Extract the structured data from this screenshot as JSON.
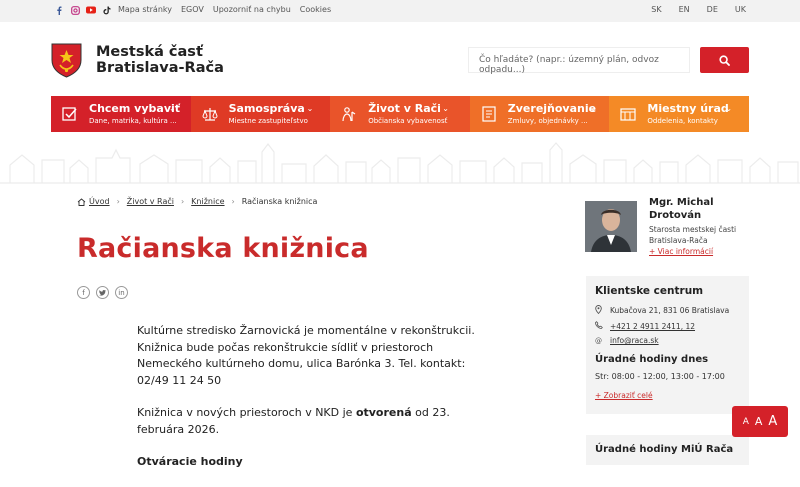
{
  "topbar": {
    "social": [
      "facebook-icon",
      "instagram-icon",
      "youtube-icon",
      "tiktok-icon"
    ],
    "links": [
      "Mapa stránky",
      "EGOV",
      "Upozorniť na chybu",
      "Cookies"
    ],
    "languages": [
      "SK",
      "EN",
      "DE",
      "UK"
    ]
  },
  "header": {
    "logo_line1": "Mestská časť",
    "logo_line2": "Bratislava-Rača",
    "search_placeholder": "Čo hľadáte? (napr.: územný plán, odvoz odpadu...)"
  },
  "nav": [
    {
      "title": "Chcem vybaviť",
      "subtitle": "Dane, matrika, kultúra ...",
      "color": "#d42129",
      "icon": "checkbox-icon"
    },
    {
      "title": "Samospráva",
      "subtitle": "Miestne zastupiteľstvo",
      "color": "#df3a25",
      "icon": "scales-icon"
    },
    {
      "title": "Život v Rači",
      "subtitle": "Občianska vybavenosť",
      "color": "#e9542a",
      "icon": "person-icon"
    },
    {
      "title": "Zverejňovanie",
      "subtitle": "Zmluvy, objednávky ...",
      "color": "#ef6f28",
      "icon": "document-icon"
    },
    {
      "title": "Miestny úrad",
      "subtitle": "Oddelenia, kontakty",
      "color": "#f48a26",
      "icon": "building-icon"
    }
  ],
  "breadcrumb": [
    "Úvod",
    "Život v Rači",
    "Knižnice",
    "Račianska knižnica"
  ],
  "page_title": "Račianska knižnica",
  "content": {
    "p1": "Kultúrne stredisko Žarnovická je momentálne v rekonštrukcii. Knižnica bude počas rekonštrukcie sídliť v priestoroch Nemeckého kultúrneho domu, ulica Barónka 3. Tel. kontakt:  02/49 11 24 50",
    "p2_a": "Knižnica v nových priestoroch v NKD je ",
    "p2_b": "otvorená",
    "p2_c": " od 23. februára 2026.",
    "p3": "Otváracie hodiny"
  },
  "mayor": {
    "name_line1": "Mgr. Michal",
    "name_line2": "Drotován",
    "role_line1": "Starosta mestskej časti",
    "role_line2": "Bratislava-Rača",
    "more": "+ Viac informácií"
  },
  "client_center": {
    "title": "Klientske centrum",
    "address": "Kubačova 21, 831 06 Bratislava",
    "phone": "+421 2 4911 2411, 12",
    "email": "info@raca.sk",
    "hours_title": "Úradné hodiny dnes",
    "hours": "Str: 08:00 - 12:00, 13:00 - 17:00",
    "show_all": "+ Zobraziť celé"
  },
  "next_box_title": "Úradné hodiny MiÚ Rača",
  "a11y": [
    "A",
    "A",
    "A"
  ]
}
